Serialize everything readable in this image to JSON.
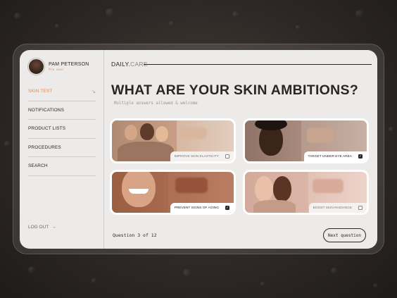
{
  "user": {
    "name": "PAM PETERSON",
    "role": "Pro user"
  },
  "nav": {
    "items": [
      {
        "label": "SKIN TEST",
        "active": true
      },
      {
        "label": "NOTIFICATIONS",
        "active": false
      },
      {
        "label": "PRODUCT LISTS",
        "active": false
      },
      {
        "label": "PROCEDURES",
        "active": false
      },
      {
        "label": "SEARCH",
        "active": false
      }
    ],
    "logout": "LOG OUT",
    "logout_arrow": "→",
    "active_arrow": "↘"
  },
  "brand": {
    "name": "DAILY.",
    "accent": "CARE"
  },
  "question": {
    "title": "WHAT ARE YOUR SKIN AMBITIONS?",
    "subtitle": "Multiple answers allowed & welcome",
    "counter": "Question 3 of 12"
  },
  "options": [
    {
      "label": "IMPROVE SKIN ELASTICITY",
      "checked": false
    },
    {
      "label": "TARGET UNDER EYE AREA",
      "checked": true
    },
    {
      "label": "PREVENT SIGNS OF AGING",
      "checked": true
    },
    {
      "label": "BOOST SKIN RADIANCE",
      "checked": false
    }
  ],
  "next_button": "Next question",
  "colors": {
    "accent": "#e2875b",
    "text": "#2b2625",
    "card": "#ecebea",
    "backdrop": "#2e2926"
  }
}
